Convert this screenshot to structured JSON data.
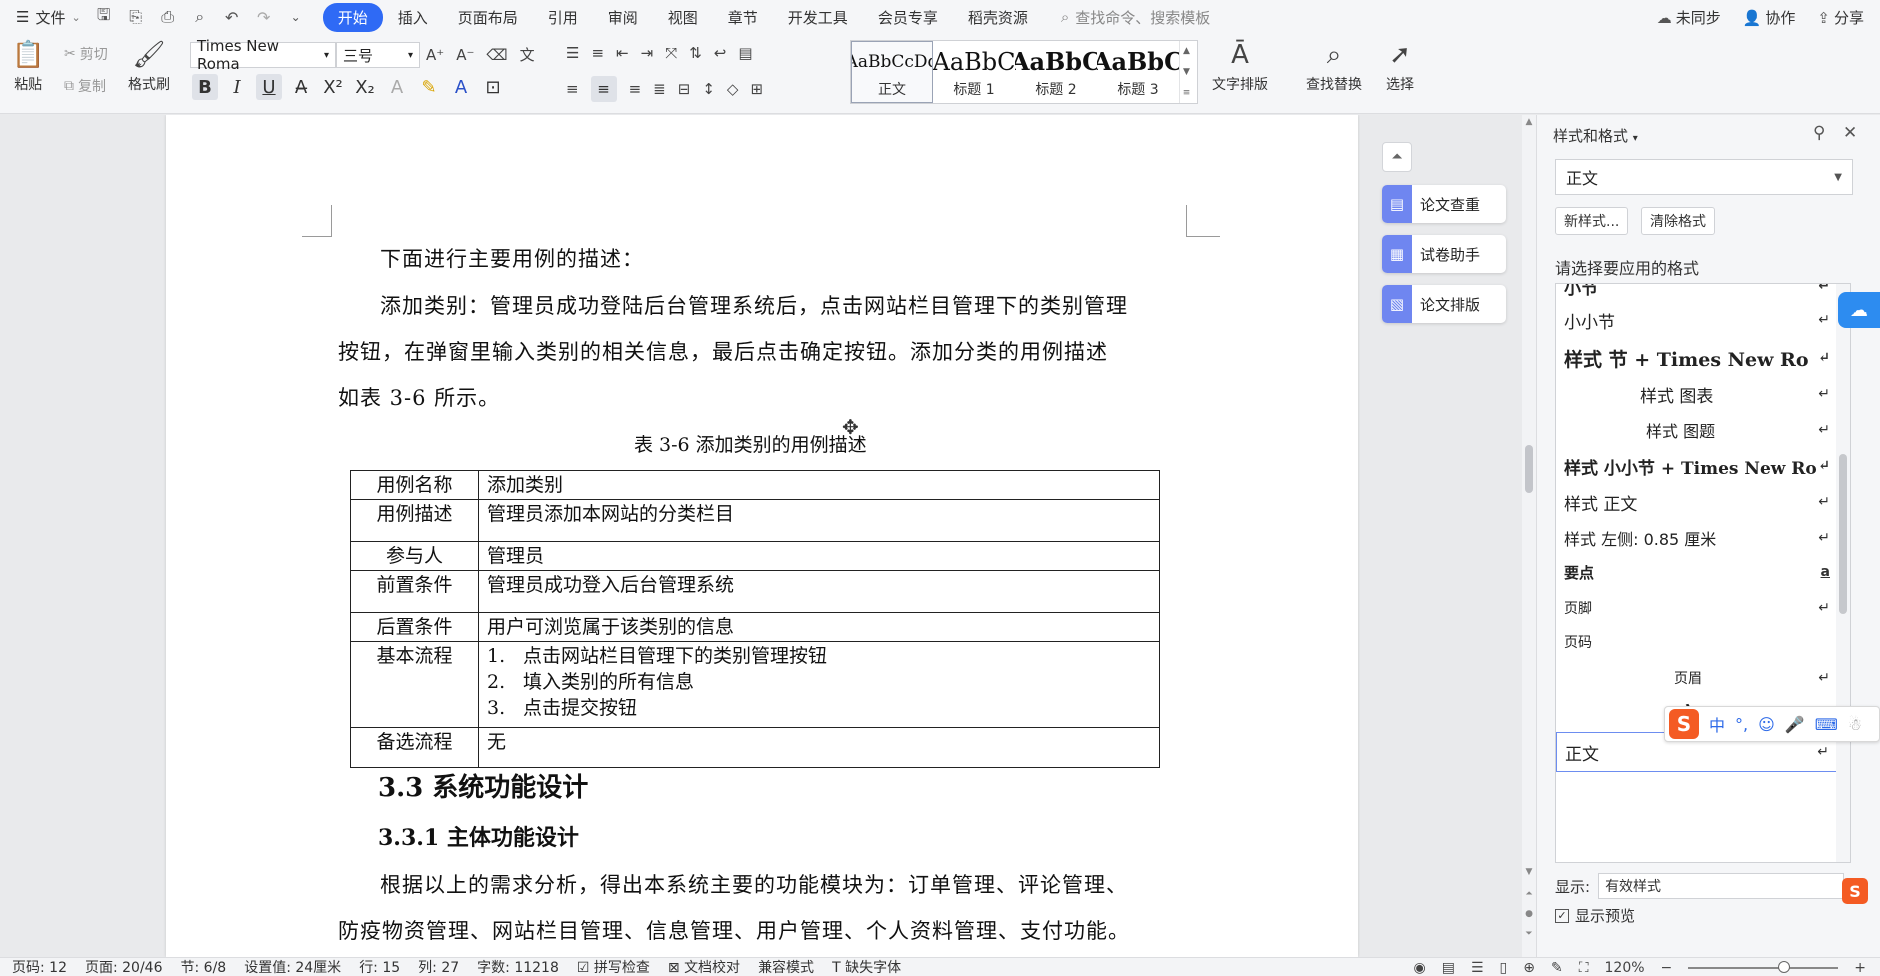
{
  "menubar": {
    "file_label": "文件",
    "tabs": [
      "开始",
      "插入",
      "页面布局",
      "引用",
      "审阅",
      "视图",
      "章节",
      "开发工具",
      "会员专享",
      "稻壳资源"
    ],
    "active_tab": "开始",
    "search_placeholder": "查找命令、搜索模板",
    "right": {
      "sync": "未同步",
      "collab": "协作",
      "share": "分享"
    }
  },
  "ribbon": {
    "paste": "粘贴",
    "cut": "剪切",
    "copy": "复制",
    "format_painter": "格式刷",
    "font_name": "Times New Roma",
    "font_size": "三号",
    "styles": [
      {
        "preview": "AaBbCcDd",
        "name": "正文"
      },
      {
        "preview": "AaBbC",
        "name": "标题 1"
      },
      {
        "preview": "AaBbC",
        "name": "标题 2"
      },
      {
        "preview": "AaBbC",
        "name": "标题 3"
      }
    ],
    "text_layout": "文字排版",
    "find_replace": "查找替换",
    "select": "选择"
  },
  "document": {
    "p1": "下面进行主要用例的描述：",
    "p2_line1": "添加类别：管理员成功登陆后台管理系统后，点击网站栏目管理下的类别管理",
    "p2_line2": "按钮，在弹窗里输入类别的相关信息，最后点击确定按钮。添加分类的用例描述",
    "p2_line3": "如表 3-6 所示。",
    "table_caption": "表 3-6  添加类别的用例描述",
    "table": [
      {
        "key": "用例名称",
        "value": "添加类别"
      },
      {
        "key": "用例描述",
        "value": "管理员添加本网站的分类栏目"
      },
      {
        "key": "参与人",
        "value": "管理员"
      },
      {
        "key": "前置条件",
        "value": "管理员成功登入后台管理系统"
      },
      {
        "key": "后置条件",
        "value": "用户可浏览属于该类别的信息"
      },
      {
        "key": "基本流程",
        "steps": [
          {
            "n": "1.",
            "t": "点击网站栏目管理下的类别管理按钮"
          },
          {
            "n": "2.",
            "t": "填入类别的所有信息"
          },
          {
            "n": "3.",
            "t": "点击提交按钮"
          }
        ]
      },
      {
        "key": "备选流程",
        "value": "无"
      }
    ],
    "h2": "3.3    系统功能设计",
    "h3": "3.3.1    主体功能设计",
    "p3_line1": "根据以上的需求分析，得出本系统主要的功能模块为：订单管理、评论管理、",
    "p3_line2": "防疫物资管理、网站栏目管理、信息管理、用户管理、个人资料管理、支付功能。"
  },
  "side_tools": [
    "论文查重",
    "试卷助手",
    "论文排版"
  ],
  "pane": {
    "title": "样式和格式",
    "current_style": "正文",
    "new_style": "新样式...",
    "clear_format": "清除格式",
    "choose_label": "请选择要应用的格式",
    "items": [
      {
        "label": "小节",
        "mark": "↵"
      },
      {
        "label": "小小节",
        "mark": "↵"
      },
      {
        "label": "样式  节  + Times New Ro",
        "mark": "↵"
      },
      {
        "label": "样式  图表",
        "mark": "↵"
      },
      {
        "label": "样式  图题",
        "mark": "↵"
      },
      {
        "label": "样式  小小节  + Times New Ro",
        "mark": "↵"
      },
      {
        "label": "样式  正文",
        "mark": "↵"
      },
      {
        "label": "样式  左侧:   0.85  厘米",
        "mark": "↵"
      },
      {
        "label": "要点",
        "mark": "a"
      },
      {
        "label": "页脚",
        "mark": "↵"
      },
      {
        "label": "页码",
        "mark": ""
      },
      {
        "label": "页眉",
        "mark": "↵"
      },
      {
        "label": "章",
        "mark": "↵"
      },
      {
        "label": "正文",
        "mark": "↵"
      }
    ],
    "show_label": "显示:",
    "show_value": "有效样式",
    "preview_label": "显示预览"
  },
  "ime": {
    "lang": "中"
  },
  "statusbar": {
    "page_num": "页码: 12",
    "pages": "页面: 20/46",
    "section": "节: 6/8",
    "setting": "设置值: 24厘米",
    "row": "行: 15",
    "col": "列: 27",
    "words": "字数: 11218",
    "spell": "拼写检查",
    "doc_check": "文档校对",
    "compat": "兼容模式",
    "missing_font": "缺失字体",
    "zoom": "120%"
  }
}
